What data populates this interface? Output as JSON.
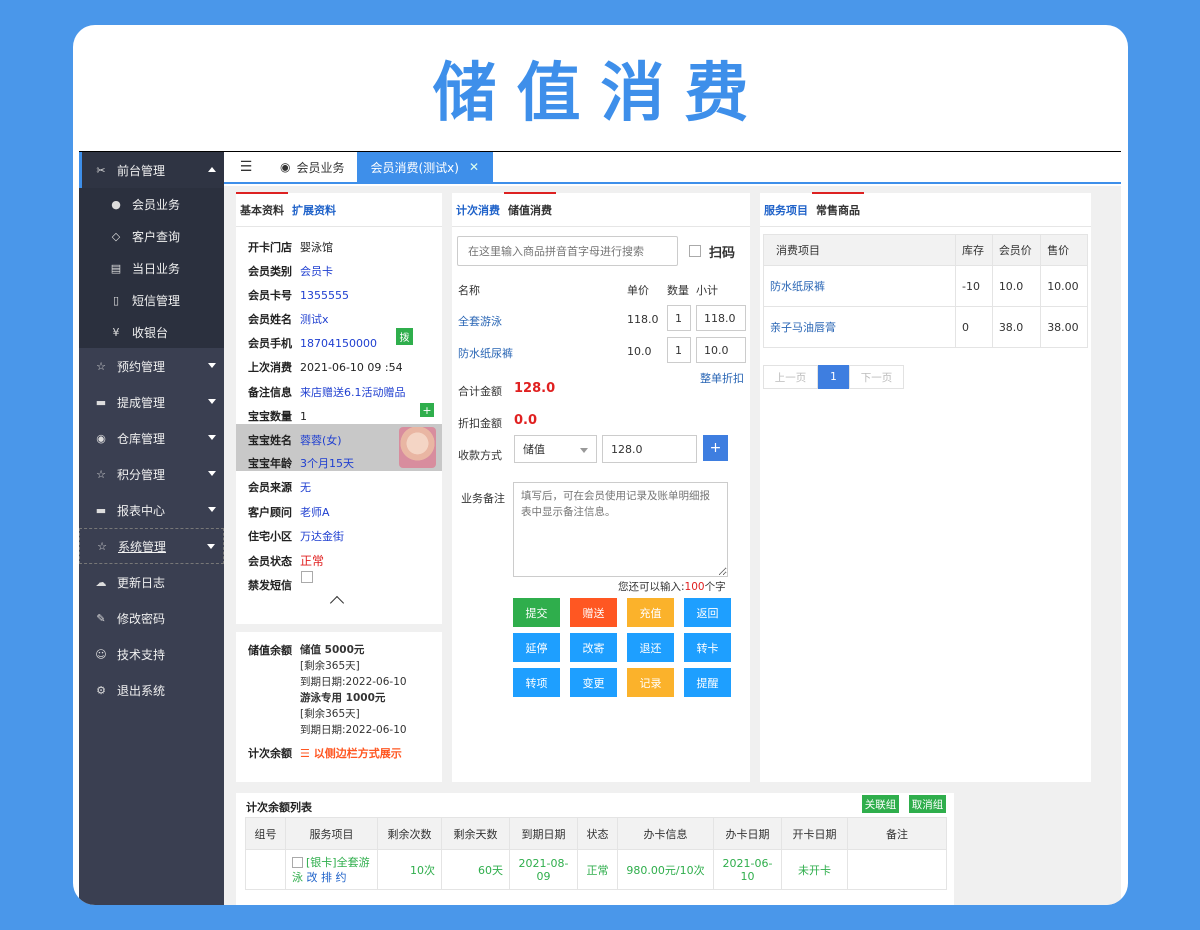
{
  "banner": {
    "title": "储值消费"
  },
  "sidebar": {
    "items": [
      {
        "label": "前台管理"
      },
      {
        "label": "会员业务"
      },
      {
        "label": "客户查询"
      },
      {
        "label": "当日业务"
      },
      {
        "label": "短信管理"
      },
      {
        "label": "收银台"
      },
      {
        "label": "预约管理"
      },
      {
        "label": "提成管理"
      },
      {
        "label": "仓库管理"
      },
      {
        "label": "积分管理"
      },
      {
        "label": "报表中心"
      },
      {
        "label": "系统管理"
      },
      {
        "label": "更新日志"
      },
      {
        "label": "修改密码"
      },
      {
        "label": "技术支持"
      },
      {
        "label": "退出系统"
      }
    ]
  },
  "tabs": {
    "home": "会员业务",
    "active": "会员消费(测试x)"
  },
  "member": {
    "tab_basic": "基本资料",
    "tab_ext": "扩展资料",
    "fields": [
      {
        "label": "开卡门店",
        "value": "婴泳馆"
      },
      {
        "label": "会员类别",
        "value": "会员卡"
      },
      {
        "label": "会员卡号",
        "value": "1355555"
      },
      {
        "label": "会员姓名",
        "value": "测试x"
      },
      {
        "label": "会员手机",
        "value": "18704150000"
      },
      {
        "label": "上次消费",
        "value": "2021-06-10 09 :54"
      },
      {
        "label": "备注信息",
        "value": "来店赠送6.1活动赠品"
      },
      {
        "label": "宝宝数量",
        "value": "1"
      },
      {
        "label": "宝宝姓名",
        "value": "蓉蓉(女)"
      },
      {
        "label": "宝宝年龄",
        "value": "3个月15天"
      },
      {
        "label": "会员来源",
        "value": "无"
      },
      {
        "label": "客户顾问",
        "value": "老师A"
      },
      {
        "label": "住宅小区",
        "value": "万达金街"
      },
      {
        "label": "会员状态",
        "value": "正常"
      },
      {
        "label": "禁发短信",
        "value": ""
      }
    ],
    "dial_label": "拨",
    "balance_label": "储值余额",
    "balances": [
      {
        "name": "储值 5000元",
        "remain": "[剩余365天]",
        "expire": "到期日期:2022-06-10"
      },
      {
        "name": "游泳专用 1000元",
        "remain": "[剩余365天]",
        "expire": "到期日期:2022-06-10"
      }
    ],
    "count_label": "计次余额",
    "count_value": "☰ 以侧边栏方式展示"
  },
  "consume": {
    "tab_count": "计次消费",
    "tab_stored": "储值消费",
    "search_placeholder": "在这里输入商品拼音首字母进行搜索",
    "scan_label": "扫码",
    "headers": {
      "name": "名称",
      "price": "单价",
      "qty": "数量",
      "subtotal": "小计"
    },
    "items": [
      {
        "name": "全套游泳",
        "price": "118.0",
        "qty": "1",
        "subtotal": "118.0"
      },
      {
        "name": "防水纸尿裤",
        "price": "10.0",
        "qty": "1",
        "subtotal": "10.0"
      }
    ],
    "discount_all": "整单折扣",
    "total_label": "合计金额",
    "total_value": "128.0",
    "discount_label": "折扣金额",
    "discount_value": "0.0",
    "pay_label": "收款方式",
    "pay_method": "储值",
    "pay_amount": "128.0",
    "remark_label": "业务备注",
    "remark_placeholder": "填写后，可在会员使用记录及账单明细报表中显示备注信息。",
    "remain_prefix": "您还可以输入:",
    "remain_count": "100",
    "remain_suffix": "个字",
    "buttons": [
      {
        "label": "提交",
        "color": "#2fae4c"
      },
      {
        "label": "赠送",
        "color": "#ff5722"
      },
      {
        "label": "充值",
        "color": "#fbb22b"
      },
      {
        "label": "返回",
        "color": "#1e9fff"
      },
      {
        "label": "延停",
        "color": "#1e9fff"
      },
      {
        "label": "改寄",
        "color": "#1e9fff"
      },
      {
        "label": "退还",
        "color": "#1e9fff"
      },
      {
        "label": "转卡",
        "color": "#1e9fff"
      },
      {
        "label": "转项",
        "color": "#1e9fff"
      },
      {
        "label": "变更",
        "color": "#1e9fff"
      },
      {
        "label": "记录",
        "color": "#fbb22b"
      },
      {
        "label": "提醒",
        "color": "#1e9fff"
      }
    ]
  },
  "service": {
    "tab_service": "服务项目",
    "tab_goods": "常售商品",
    "headers": [
      "消费项目",
      "库存",
      "会员价",
      "售价"
    ],
    "rows": [
      [
        "防水纸尿裤",
        "-10",
        "10.0",
        "10.00"
      ],
      [
        "亲子马油唇膏",
        "0",
        "38.0",
        "38.00"
      ]
    ],
    "pager": {
      "prev": "上一页",
      "page": "1",
      "next": "下一页"
    }
  },
  "count_list": {
    "title": "计次余额列表",
    "link_btn": "关联组",
    "unlink_btn": "取消组",
    "headers": [
      "组号",
      "服务项目",
      "剩余次数",
      "剩余天数",
      "到期日期",
      "状态",
      "办卡信息",
      "办卡日期",
      "开卡日期",
      "备注"
    ],
    "row": {
      "group": "",
      "service": "[银卡]全套游泳",
      "actions": "改 排 约",
      "remain_times": "10次",
      "remain_days": "60天",
      "expire": "2021-08-09",
      "status": "正常",
      "card_info": "980.00元/10次",
      "card_date": "2021-06-10",
      "open_date": "未开卡",
      "note": ""
    }
  }
}
